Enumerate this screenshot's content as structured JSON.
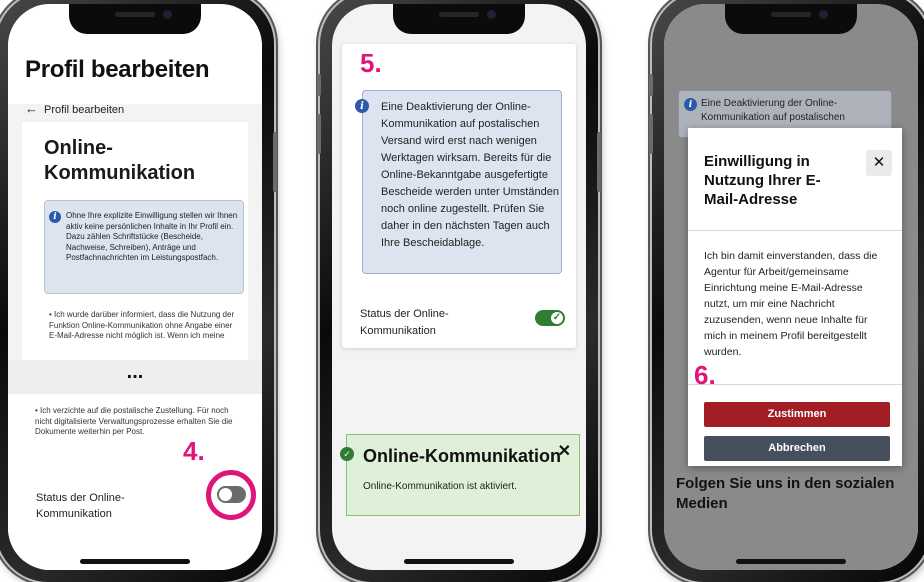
{
  "screen1": {
    "page_title": "Profil bearbeiten",
    "back_label": "Profil bearbeiten",
    "section_title": "Online-Kommunikation",
    "info_text": "Ohne Ihre explizite Einwilligung stellen wir Ihnen aktiv keine persönlichen Inhalte in Ihr Profil ein. Dazu zählen Schriftstücke (Bescheide, Nachweise, Schreiben), Anträge und Postfachnachrichten im Leistungspostfach.",
    "bullet1": "Ich wurde darüber informiert, dass die Nutzung der Funktion Online-Kommunikation ohne Angabe einer E-Mail-Adresse nicht möglich ist. Wenn ich meine",
    "ellipsis": "...",
    "bullet2": "Ich verzichte auf die postalische Zustellung. Für noch nicht digitalisierte Verwaltungsprozesse erhalten Sie die Dokumente weiterhin per Post.",
    "status_label": "Status der Online-Kommunikation",
    "toggle_on": false,
    "step_label": "4."
  },
  "screen2": {
    "step_label": "5.",
    "info_text": "Eine Deaktivierung der Online-Kommunikation auf postalischen Versand wird erst nach wenigen Werktagen wirksam. Bereits für die Online-Bekanntgabe ausgefertigte Bescheide werden unter Umständen noch online zugestellt. Prüfen Sie daher in den nächsten Tagen auch Ihre Bescheidablage.",
    "status_label": "Status der Online-Kommunikation",
    "toggle_on": true,
    "toast_title": "Online-Kommunikation",
    "toast_message": "Online-Kommunikation ist aktiviert.",
    "close_glyph": "✕"
  },
  "screen3": {
    "background_info_text": "Eine Deaktivierung der Online-Kommunikation auf postalischen",
    "background_heading": "Folgen Sie uns in den sozialen Medien",
    "modal_title": "Einwilligung in Nutzung Ihrer E-Mail-Adresse",
    "modal_close_glyph": "✕",
    "modal_body": "Ich bin damit einverstanden, dass die Agentur für Arbeit/gemeinsame Einrichtung meine E-Mail-Adresse nutzt, um mir eine Nachricht zuzusenden, wenn neue Inhalte für mich in meinem Profil bereitgestellt wurden.",
    "step_label": "6.",
    "agree_label": "Zustimmen",
    "cancel_label": "Abbrechen"
  },
  "colors": {
    "step_accent": "#e0157a",
    "info_box": "#dde4ef",
    "toggle_on": "#2e7d32",
    "success_bg": "#dff0d8",
    "agree_button": "#a11f24",
    "cancel_button": "#454f5e"
  },
  "icons": {
    "info": "info-icon",
    "back": "arrow-left-icon",
    "close": "close-icon",
    "check": "check-circle-icon"
  }
}
